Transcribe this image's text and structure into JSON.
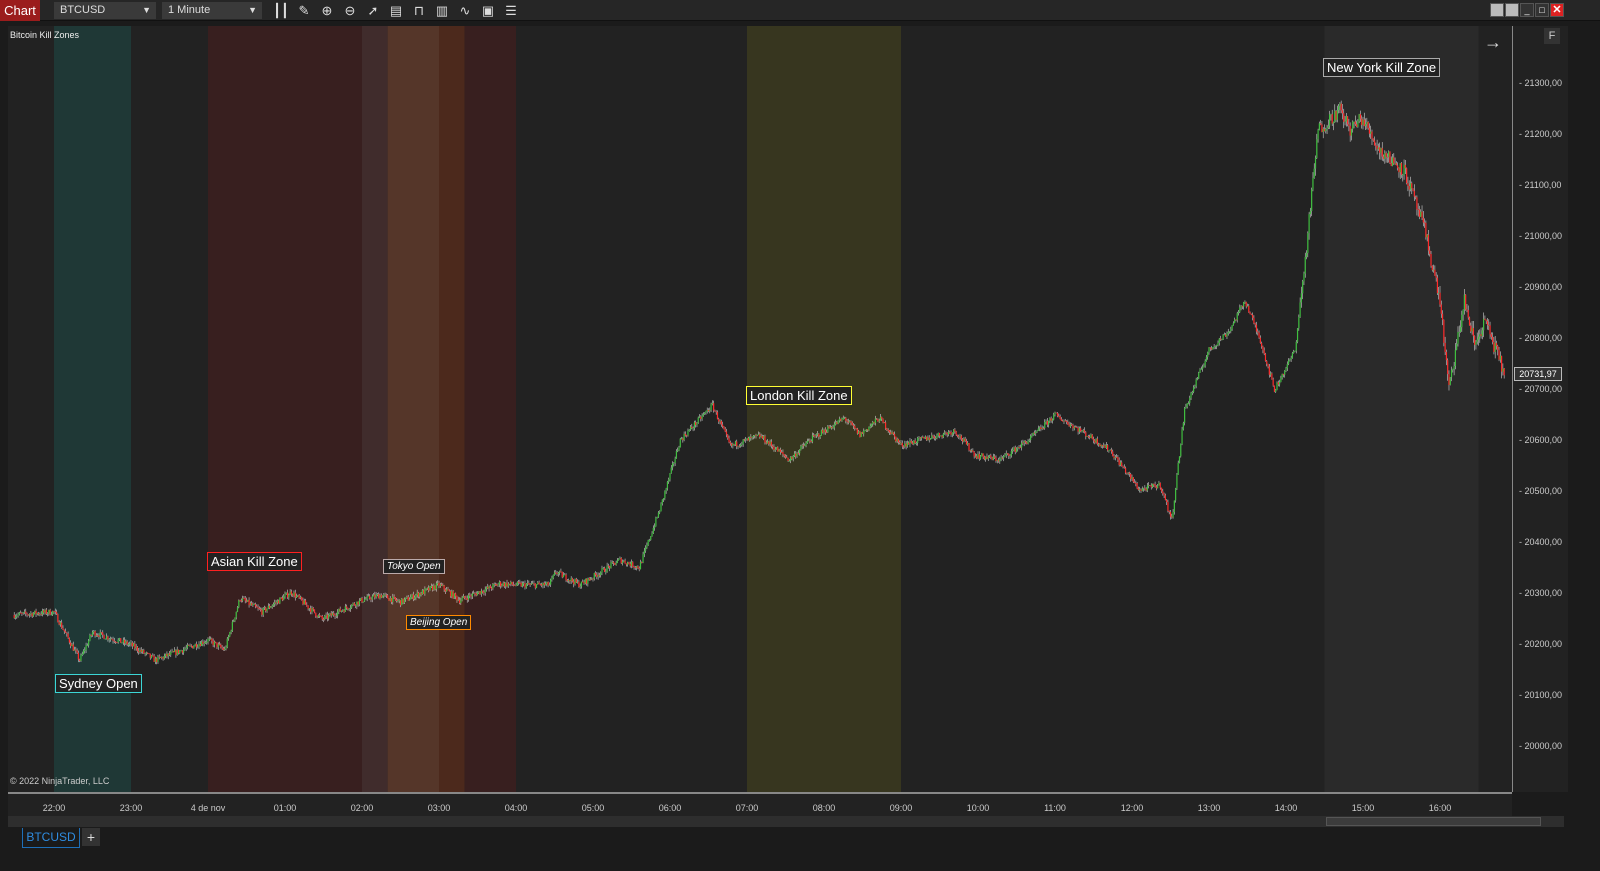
{
  "toolbar": {
    "chart_label": "Chart",
    "instrument": "BTCUSD",
    "interval": "1 Minute",
    "tools": [
      "bar-type-icon",
      "pencil-icon",
      "zoom-in-icon",
      "zoom-out-icon",
      "pointer-icon",
      "data-box-icon",
      "properties-icon",
      "indicators-icon",
      "strategies-icon",
      "templates-icon",
      "list-icon"
    ]
  },
  "chart_title": "Bitcoin Kill Zones",
  "copyright": "© 2022 NinjaTrader, LLC",
  "colors": {
    "up": "#3fbf3f",
    "down": "#ff2a2a",
    "wick": "#d0d0d0",
    "background": "#222222"
  },
  "zones": [
    {
      "start": "22:00",
      "end": "23:00",
      "color": "#1f3836"
    },
    {
      "start": "00:00",
      "end": "02:00",
      "color": "#381f1f"
    },
    {
      "start": "02:00",
      "end": "02:20",
      "color": "#402c2c"
    },
    {
      "start": "02:20",
      "end": "03:00",
      "color": "#553629"
    },
    {
      "start": "03:00",
      "end": "03:20",
      "color": "#4c291c"
    },
    {
      "start": "03:20",
      "end": "04:00",
      "color": "#381f1f"
    },
    {
      "start": "07:00",
      "end": "09:00",
      "color": "#37361f"
    },
    {
      "start": "14:30",
      "end": "16:30",
      "color": "#2a2a2a"
    }
  ],
  "zone_labels": [
    {
      "text": "Sydney Open",
      "color": "#3cd6d6"
    },
    {
      "text": "Asian Kill Zone",
      "color": "#ff2020"
    },
    {
      "text": "Tokyo Open",
      "color": "#bbaaaa"
    },
    {
      "text": "Beijing Open",
      "color": "#ff8a00"
    },
    {
      "text": "London Kill Zone",
      "color": "#ffff33"
    },
    {
      "text": "New York Kill Zone",
      "color": "#aaaaaa"
    }
  ],
  "chart_data": {
    "type": "candlestick",
    "interval": "1 Minute",
    "ylim": [
      19950,
      21420
    ],
    "grid": false,
    "yticks": [
      "20000,00",
      "20100,00",
      "20200,00",
      "20300,00",
      "20400,00",
      "20500,00",
      "20600,00",
      "20700,00",
      "20800,00",
      "20900,00",
      "21000,00",
      "21100,00",
      "21200,00",
      "21300,00"
    ],
    "xticks": [
      "22:00",
      "23:00",
      "4 de nov",
      "01:00",
      "02:00",
      "03:00",
      "04:00",
      "05:00",
      "06:00",
      "07:00",
      "08:00",
      "09:00",
      "10:00",
      "11:00",
      "12:00",
      "13:00",
      "14:00",
      "15:00",
      "16:00"
    ],
    "last_price": "20731,97",
    "price_path": [
      [
        "21:29",
        20259
      ],
      [
        "22:00",
        20265
      ],
      [
        "22:20",
        20170
      ],
      [
        "22:30",
        20225
      ],
      [
        "23:00",
        20200
      ],
      [
        "23:19",
        20170
      ],
      [
        "00:00",
        20210
      ],
      [
        "00:13",
        20190
      ],
      [
        "00:25",
        20292
      ],
      [
        "00:42",
        20265
      ],
      [
        "01:05",
        20304
      ],
      [
        "01:29",
        20250
      ],
      [
        "02:00",
        20288
      ],
      [
        "02:14",
        20298
      ],
      [
        "02:30",
        20284
      ],
      [
        "03:00",
        20318
      ],
      [
        "03:16",
        20288
      ],
      [
        "03:47",
        20320
      ],
      [
        "04:00",
        20318
      ],
      [
        "04:26",
        20318
      ],
      [
        "04:31",
        20343
      ],
      [
        "04:50",
        20318
      ],
      [
        "05:21",
        20367
      ],
      [
        "05:36",
        20352
      ],
      [
        "05:52",
        20465
      ],
      [
        "06:08",
        20602
      ],
      [
        "06:33",
        20670
      ],
      [
        "06:47",
        20590
      ],
      [
        "07:10",
        20610
      ],
      [
        "07:33",
        20563
      ],
      [
        "07:49",
        20602
      ],
      [
        "08:16",
        20645
      ],
      [
        "08:28",
        20612
      ],
      [
        "08:43",
        20645
      ],
      [
        "09:00",
        20592
      ],
      [
        "09:15",
        20602
      ],
      [
        "09:42",
        20620
      ],
      [
        "09:58",
        20572
      ],
      [
        "10:17",
        20563
      ],
      [
        "10:40",
        20603
      ],
      [
        "11:00",
        20651
      ],
      [
        "11:19",
        20622
      ],
      [
        "11:43",
        20582
      ],
      [
        "12:06",
        20504
      ],
      [
        "12:22",
        20514
      ],
      [
        "12:31",
        20445
      ],
      [
        "12:41",
        20661
      ],
      [
        "13:00",
        20778
      ],
      [
        "13:16",
        20817
      ],
      [
        "13:28",
        20876
      ],
      [
        "13:40",
        20798
      ],
      [
        "13:51",
        20700
      ],
      [
        "14:07",
        20778
      ],
      [
        "14:15",
        20955
      ],
      [
        "14:25",
        21210
      ],
      [
        "14:42",
        21249
      ],
      [
        "14:50",
        21210
      ],
      [
        "14:59",
        21233
      ],
      [
        "15:13",
        21170
      ],
      [
        "15:32",
        21131
      ],
      [
        "15:48",
        21014
      ],
      [
        "16:00",
        20876
      ],
      [
        "16:07",
        20700
      ],
      [
        "16:19",
        20876
      ],
      [
        "16:27",
        20788
      ],
      [
        "16:35",
        20837
      ],
      [
        "16:50",
        20732
      ]
    ]
  },
  "tabs": [
    {
      "label": "BTCUSD"
    }
  ],
  "add_tab": "+",
  "price_marker_arrow": "→",
  "f_button": "F"
}
